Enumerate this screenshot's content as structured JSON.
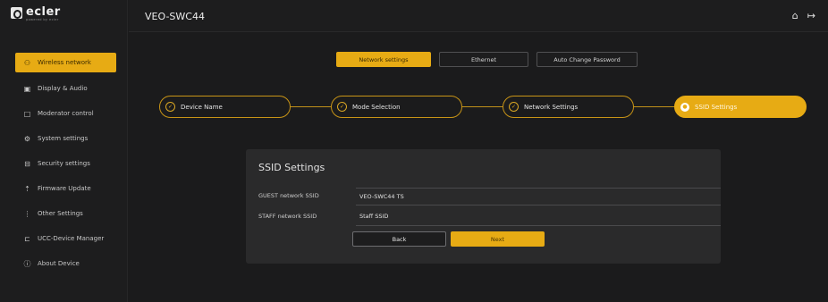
{
  "brand": {
    "name": "ecler",
    "tagline": "powered by ecler"
  },
  "header": {
    "title": "VEO-SWC44",
    "home_icon": "⌂",
    "logout_icon": "↦"
  },
  "sidebar": {
    "items": [
      {
        "label": "Wireless network",
        "icon": "network-icon",
        "glyph": "⚇",
        "active": true
      },
      {
        "label": "Display & Audio",
        "icon": "display-icon",
        "glyph": "▣",
        "active": false
      },
      {
        "label": "Moderator control",
        "icon": "moderator-icon",
        "glyph": "□",
        "active": false
      },
      {
        "label": "System settings",
        "icon": "gear-icon",
        "glyph": "⚙",
        "active": false
      },
      {
        "label": "Security settings",
        "icon": "lock-icon",
        "glyph": "⊟",
        "active": false
      },
      {
        "label": "Firmware Update",
        "icon": "upload-icon",
        "glyph": "⇡",
        "active": false
      },
      {
        "label": "Other Settings",
        "icon": "sliders-icon",
        "glyph": "⋮",
        "active": false
      },
      {
        "label": "UCC-Device Manager",
        "icon": "device-manager-icon",
        "glyph": "⊏",
        "active": false
      },
      {
        "label": "About Device",
        "icon": "info-icon",
        "glyph": "ⓘ",
        "active": false
      }
    ]
  },
  "tabs": [
    {
      "label": "Network settings",
      "active": true
    },
    {
      "label": "Ethernet",
      "active": false
    },
    {
      "label": "Auto Change Password",
      "active": false
    }
  ],
  "stepper": {
    "steps": [
      {
        "label": "Device Name",
        "state": "done"
      },
      {
        "label": "Mode Selection",
        "state": "done"
      },
      {
        "label": "Network Settings",
        "state": "done"
      },
      {
        "label": "SSID Settings",
        "state": "current"
      }
    ],
    "check_glyph": "✓",
    "current_glyph": "●"
  },
  "card": {
    "title": "SSID Settings",
    "fields": [
      {
        "label": "GUEST network SSID",
        "value": "VEO-SWC44 TS"
      },
      {
        "label": "STAFF network SSID",
        "value": "Staff SSID"
      }
    ],
    "back_label": "Back",
    "next_label": "Next"
  },
  "colors": {
    "accent": "#e7ab14",
    "background": "#1b1b1c",
    "card": "#2a2a2b"
  }
}
